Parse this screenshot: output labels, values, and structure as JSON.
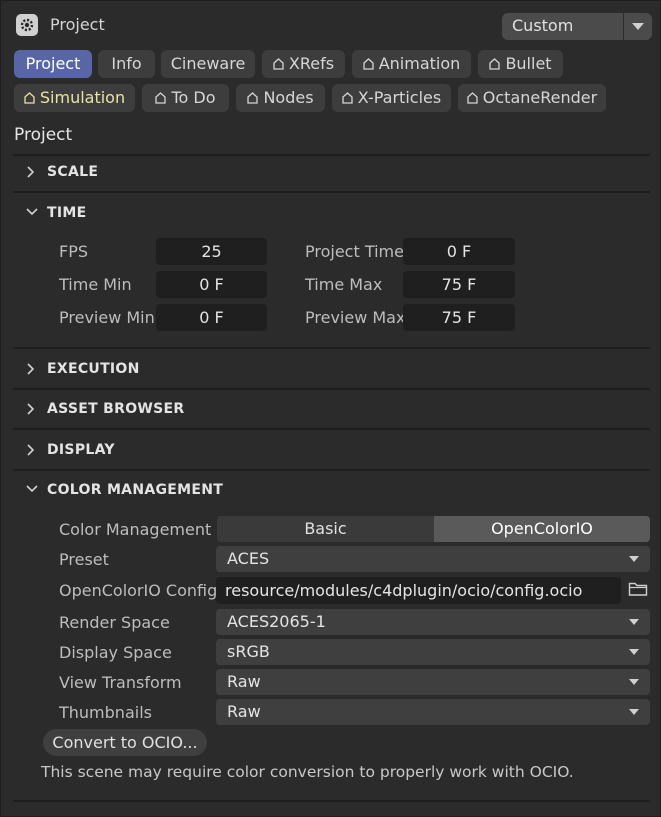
{
  "header": {
    "title": "Project",
    "preset": "Custom"
  },
  "tabs": [
    {
      "label": "Project",
      "active": true
    },
    {
      "label": "Info"
    },
    {
      "label": "Cineware"
    },
    {
      "label": "XRefs",
      "icon": "home-icon"
    },
    {
      "label": "Animation",
      "icon": "home-icon"
    },
    {
      "label": "Bullet",
      "icon": "home-icon"
    },
    {
      "label": "Simulation",
      "icon": "home-icon"
    },
    {
      "label": "To Do",
      "icon": "home-icon"
    },
    {
      "label": "Nodes",
      "icon": "home-icon"
    },
    {
      "label": "X-Particles",
      "icon": "home-icon"
    },
    {
      "label": "OctaneRender",
      "icon": "home-icon"
    }
  ],
  "section_title": "Project",
  "sections": {
    "scale": "SCALE",
    "time": "TIME",
    "execution": "EXECUTION",
    "asset_browser": "ASSET BROWSER",
    "display": "DISPLAY",
    "color_management": "COLOR MANAGEMENT"
  },
  "time": {
    "fps_label": "FPS",
    "fps": "25",
    "project_time_label": "Project Time",
    "project_time": "0 F",
    "time_min_label": "Time Min",
    "time_min": "0 F",
    "time_max_label": "Time Max",
    "time_max": "75 F",
    "preview_min_label": "Preview Min",
    "preview_min": "0 F",
    "preview_max_label": "Preview Max",
    "preview_max": "75 F"
  },
  "color": {
    "mode_label": "Color Management",
    "mode_options": [
      "Basic",
      "OpenColorIO"
    ],
    "mode_selected": "OpenColorIO",
    "preset_label": "Preset",
    "preset": "ACES",
    "config_label": "OpenColorIO Config",
    "config": "resource/modules/c4dplugin/ocio/config.ocio",
    "render_space_label": "Render Space",
    "render_space": "ACES2065-1",
    "display_space_label": "Display Space",
    "display_space": "sRGB",
    "view_transform_label": "View Transform",
    "view_transform": "Raw",
    "thumbnails_label": "Thumbnails",
    "thumbnails": "Raw",
    "convert_button": "Convert to OCIO...",
    "note": "This scene may require color conversion to properly work with OCIO."
  },
  "colors": {
    "background": "#2b2b2b",
    "active_tab": "#5866a8",
    "plugin_tab_text": "#e8e4a0"
  }
}
